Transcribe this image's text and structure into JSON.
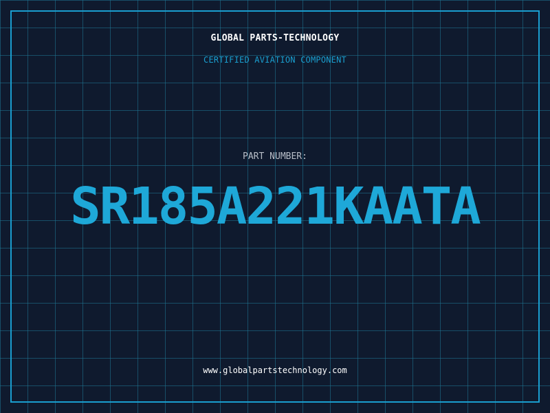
{
  "header": {
    "company_name": "GLOBAL PARTS-TECHNOLOGY",
    "tagline": "CERTIFIED AVIATION COMPONENT"
  },
  "part": {
    "label": "PART NUMBER:",
    "number": "SR185A221KAATA"
  },
  "footer": {
    "website": "www.globalpartstechnology.com"
  },
  "colors": {
    "background": "#0f1a2e",
    "grid": "#1e7896",
    "accent": "#1ea8d8",
    "frame": "#1a9fd0",
    "heading": "#ffffff",
    "label": "#b8bec8"
  }
}
